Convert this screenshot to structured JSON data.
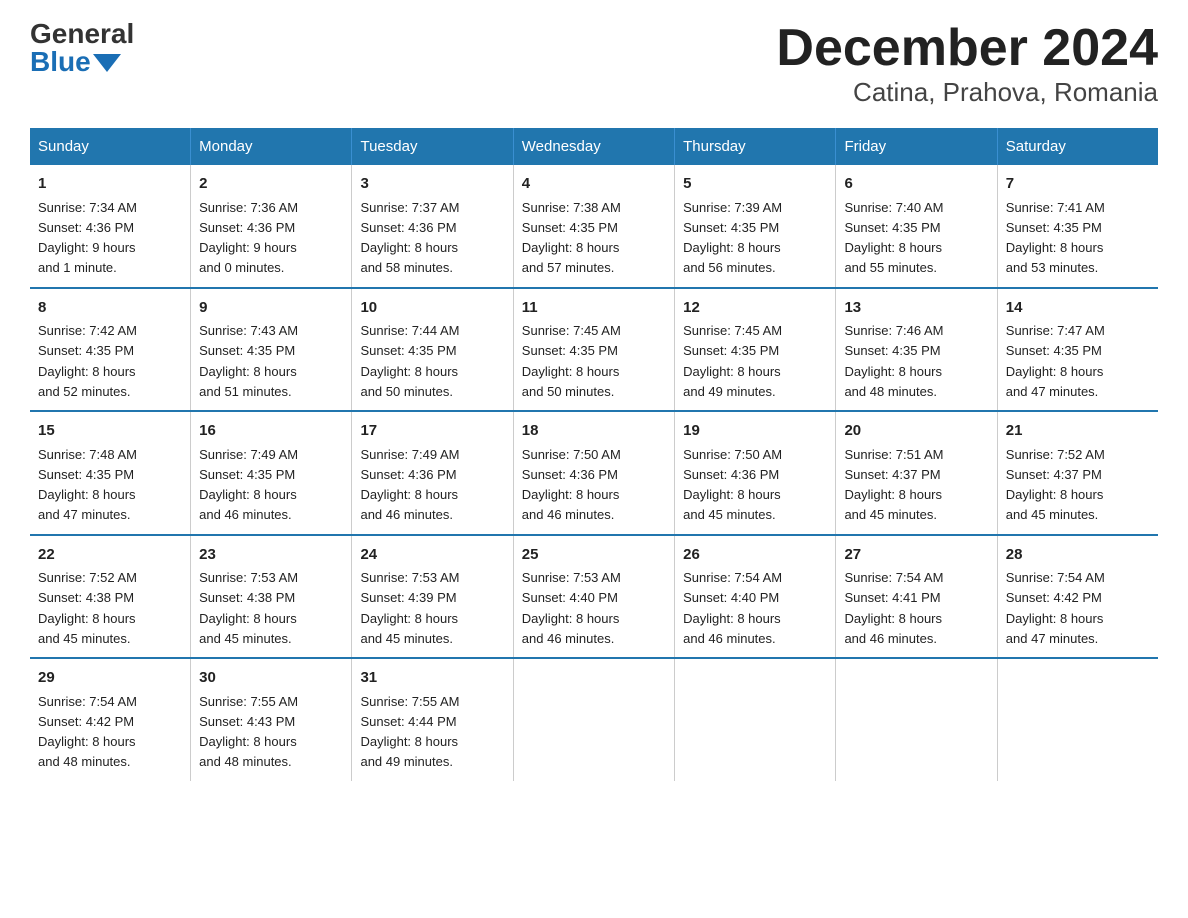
{
  "header": {
    "logo_general": "General",
    "logo_blue": "Blue",
    "title": "December 2024",
    "subtitle": "Catina, Prahova, Romania"
  },
  "days_of_week": [
    "Sunday",
    "Monday",
    "Tuesday",
    "Wednesday",
    "Thursday",
    "Friday",
    "Saturday"
  ],
  "weeks": [
    [
      {
        "day": "1",
        "sunrise": "7:34 AM",
        "sunset": "4:36 PM",
        "daylight": "9 hours and 1 minute."
      },
      {
        "day": "2",
        "sunrise": "7:36 AM",
        "sunset": "4:36 PM",
        "daylight": "9 hours and 0 minutes."
      },
      {
        "day": "3",
        "sunrise": "7:37 AM",
        "sunset": "4:36 PM",
        "daylight": "8 hours and 58 minutes."
      },
      {
        "day": "4",
        "sunrise": "7:38 AM",
        "sunset": "4:35 PM",
        "daylight": "8 hours and 57 minutes."
      },
      {
        "day": "5",
        "sunrise": "7:39 AM",
        "sunset": "4:35 PM",
        "daylight": "8 hours and 56 minutes."
      },
      {
        "day": "6",
        "sunrise": "7:40 AM",
        "sunset": "4:35 PM",
        "daylight": "8 hours and 55 minutes."
      },
      {
        "day": "7",
        "sunrise": "7:41 AM",
        "sunset": "4:35 PM",
        "daylight": "8 hours and 53 minutes."
      }
    ],
    [
      {
        "day": "8",
        "sunrise": "7:42 AM",
        "sunset": "4:35 PM",
        "daylight": "8 hours and 52 minutes."
      },
      {
        "day": "9",
        "sunrise": "7:43 AM",
        "sunset": "4:35 PM",
        "daylight": "8 hours and 51 minutes."
      },
      {
        "day": "10",
        "sunrise": "7:44 AM",
        "sunset": "4:35 PM",
        "daylight": "8 hours and 50 minutes."
      },
      {
        "day": "11",
        "sunrise": "7:45 AM",
        "sunset": "4:35 PM",
        "daylight": "8 hours and 50 minutes."
      },
      {
        "day": "12",
        "sunrise": "7:45 AM",
        "sunset": "4:35 PM",
        "daylight": "8 hours and 49 minutes."
      },
      {
        "day": "13",
        "sunrise": "7:46 AM",
        "sunset": "4:35 PM",
        "daylight": "8 hours and 48 minutes."
      },
      {
        "day": "14",
        "sunrise": "7:47 AM",
        "sunset": "4:35 PM",
        "daylight": "8 hours and 47 minutes."
      }
    ],
    [
      {
        "day": "15",
        "sunrise": "7:48 AM",
        "sunset": "4:35 PM",
        "daylight": "8 hours and 47 minutes."
      },
      {
        "day": "16",
        "sunrise": "7:49 AM",
        "sunset": "4:35 PM",
        "daylight": "8 hours and 46 minutes."
      },
      {
        "day": "17",
        "sunrise": "7:49 AM",
        "sunset": "4:36 PM",
        "daylight": "8 hours and 46 minutes."
      },
      {
        "day": "18",
        "sunrise": "7:50 AM",
        "sunset": "4:36 PM",
        "daylight": "8 hours and 46 minutes."
      },
      {
        "day": "19",
        "sunrise": "7:50 AM",
        "sunset": "4:36 PM",
        "daylight": "8 hours and 45 minutes."
      },
      {
        "day": "20",
        "sunrise": "7:51 AM",
        "sunset": "4:37 PM",
        "daylight": "8 hours and 45 minutes."
      },
      {
        "day": "21",
        "sunrise": "7:52 AM",
        "sunset": "4:37 PM",
        "daylight": "8 hours and 45 minutes."
      }
    ],
    [
      {
        "day": "22",
        "sunrise": "7:52 AM",
        "sunset": "4:38 PM",
        "daylight": "8 hours and 45 minutes."
      },
      {
        "day": "23",
        "sunrise": "7:53 AM",
        "sunset": "4:38 PM",
        "daylight": "8 hours and 45 minutes."
      },
      {
        "day": "24",
        "sunrise": "7:53 AM",
        "sunset": "4:39 PM",
        "daylight": "8 hours and 45 minutes."
      },
      {
        "day": "25",
        "sunrise": "7:53 AM",
        "sunset": "4:40 PM",
        "daylight": "8 hours and 46 minutes."
      },
      {
        "day": "26",
        "sunrise": "7:54 AM",
        "sunset": "4:40 PM",
        "daylight": "8 hours and 46 minutes."
      },
      {
        "day": "27",
        "sunrise": "7:54 AM",
        "sunset": "4:41 PM",
        "daylight": "8 hours and 46 minutes."
      },
      {
        "day": "28",
        "sunrise": "7:54 AM",
        "sunset": "4:42 PM",
        "daylight": "8 hours and 47 minutes."
      }
    ],
    [
      {
        "day": "29",
        "sunrise": "7:54 AM",
        "sunset": "4:42 PM",
        "daylight": "8 hours and 48 minutes."
      },
      {
        "day": "30",
        "sunrise": "7:55 AM",
        "sunset": "4:43 PM",
        "daylight": "8 hours and 48 minutes."
      },
      {
        "day": "31",
        "sunrise": "7:55 AM",
        "sunset": "4:44 PM",
        "daylight": "8 hours and 49 minutes."
      },
      null,
      null,
      null,
      null
    ]
  ],
  "labels": {
    "sunrise": "Sunrise:",
    "sunset": "Sunset:",
    "daylight": "Daylight:"
  }
}
